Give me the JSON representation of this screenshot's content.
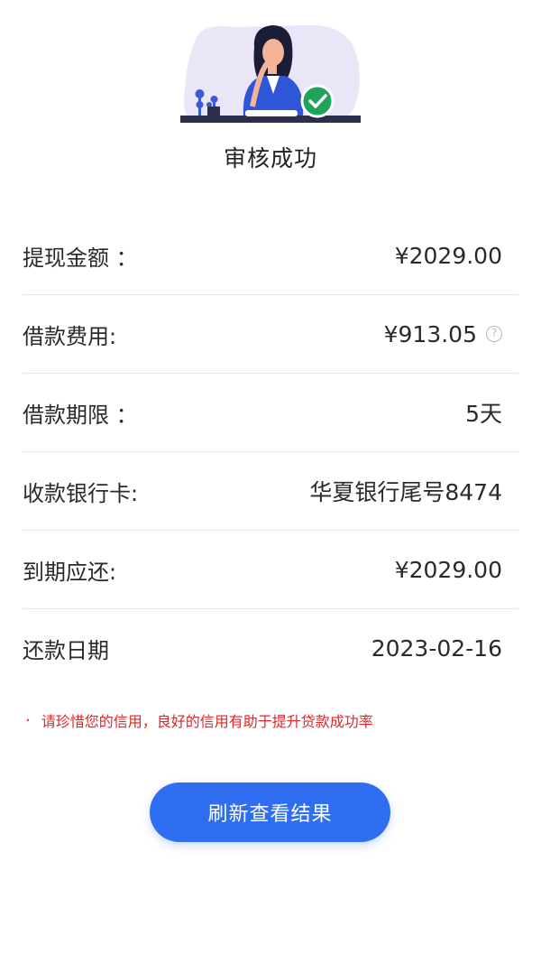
{
  "status": {
    "title": "审核成功"
  },
  "details": [
    {
      "label": "提现金额 ：",
      "value": "¥2029.00",
      "has_help": false
    },
    {
      "label": "借款费用:",
      "value": "¥913.05",
      "has_help": true
    },
    {
      "label": "借款期限 ：",
      "value": "5天",
      "has_help": false
    },
    {
      "label": "收款银行卡:",
      "value": "华夏银行尾号8474",
      "has_help": false
    },
    {
      "label": "到期应还:",
      "value": "¥2029.00",
      "has_help": false
    },
    {
      "label": "还款日期",
      "value": "2023-02-16",
      "has_help": false
    }
  ],
  "notice": {
    "bullet": "·",
    "text": "请珍惜您的信用，良好的信用有助于提升贷款成功率"
  },
  "refresh_button": {
    "label": "刷新查看结果"
  },
  "help_icon": {
    "glyph": "?"
  },
  "colors": {
    "accent": "#2f6ef0",
    "notice": "#e0262a",
    "success": "#1fa35a"
  }
}
